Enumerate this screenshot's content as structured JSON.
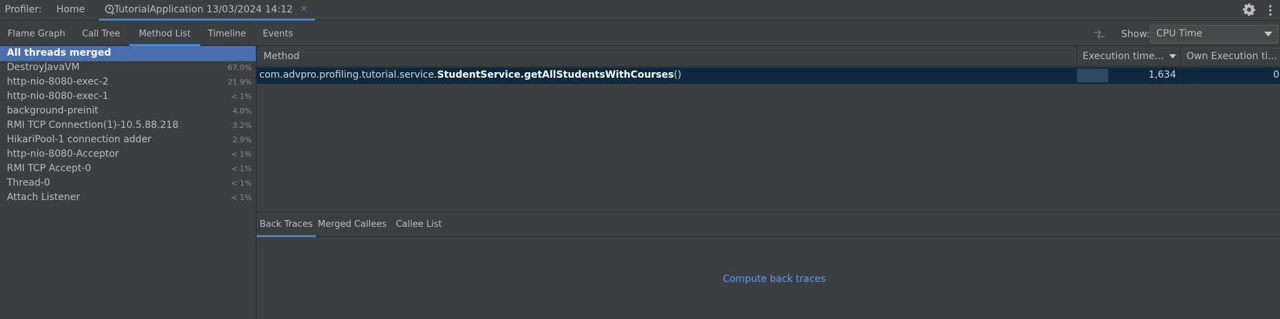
{
  "topbar": {
    "profiler_label": "Profiler:",
    "home_label": "Home",
    "session_tab_title": "TutorialApplication 13/03/2024 14:12",
    "close_glyph": "×"
  },
  "view_tabs": [
    {
      "label": "Flame Graph",
      "active": false
    },
    {
      "label": "Call Tree",
      "active": false
    },
    {
      "label": "Method List",
      "active": true
    },
    {
      "label": "Timeline",
      "active": false
    },
    {
      "label": "Events",
      "active": false
    }
  ],
  "show": {
    "label": "Show:",
    "selected": "CPU Time"
  },
  "threads": [
    {
      "name": "All threads merged",
      "pct": "",
      "selected": true
    },
    {
      "name": "DestroyJavaVM",
      "pct": "67.0%"
    },
    {
      "name": "http-nio-8080-exec-2",
      "pct": "21.9%"
    },
    {
      "name": "http-nio-8080-exec-1",
      "pct": "< 1%"
    },
    {
      "name": "background-preinit",
      "pct": "4.0%"
    },
    {
      "name": "RMI TCP Connection(1)-10.5.88.218",
      "pct": "3.2%"
    },
    {
      "name": "HikariPool-1 connection adder",
      "pct": "2.9%"
    },
    {
      "name": "http-nio-8080-Acceptor",
      "pct": "< 1%"
    },
    {
      "name": "RMI TCP Accept-0",
      "pct": "< 1%"
    },
    {
      "name": "Thread-0",
      "pct": "< 1%"
    },
    {
      "name": "Attach Listener",
      "pct": "< 1%"
    }
  ],
  "table": {
    "headers": {
      "method": "Method",
      "exec_time": "Execution time...",
      "own_exec_time": "Own Execution ti..."
    },
    "rows": [
      {
        "method_prefix": "com.advpro.profiling.tutorial.service.",
        "method_bold": "StudentService.getAllStudentsWithCourses",
        "method_suffix": "()",
        "exec_time": "1,634",
        "exec_fraction": 0.3,
        "own_exec_time": "0"
      }
    ]
  },
  "bottom_tabs": [
    {
      "label": "Back Traces",
      "active": true
    },
    {
      "label": "Merged Callees",
      "active": false
    },
    {
      "label": "Callee List",
      "active": false
    }
  ],
  "compute_link": "Compute back traces",
  "colors": {
    "background": "#3c3f41",
    "accent": "#4a88c7",
    "selection": "#4b6eaf",
    "row_selected": "#0d293e",
    "link": "#589df6"
  },
  "icons": {
    "session": "clock-run-icon",
    "settings": "gear-icon",
    "compare": "compare-arrows-icon"
  }
}
